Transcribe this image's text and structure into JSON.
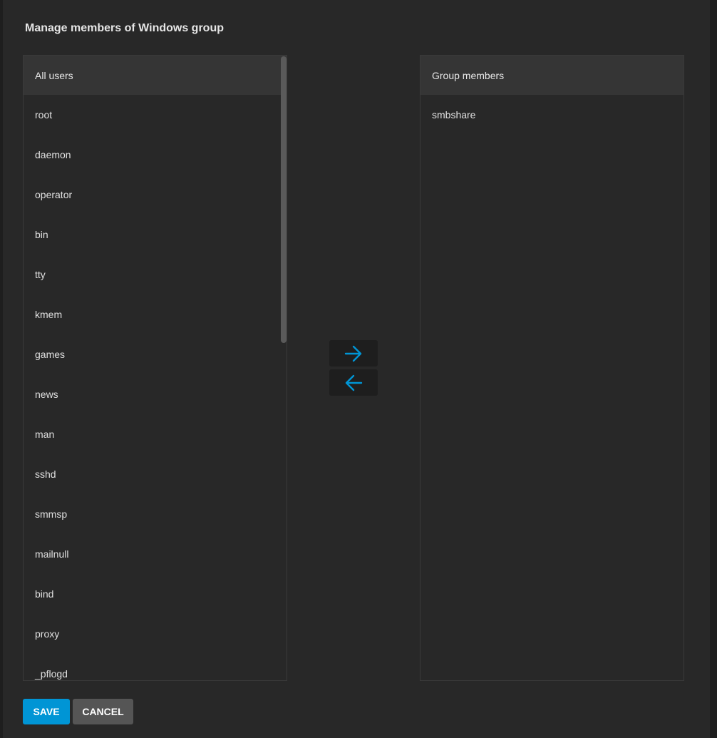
{
  "dialog": {
    "title": "Manage members of Windows group"
  },
  "all_users": {
    "header": "All users",
    "items": [
      "root",
      "daemon",
      "operator",
      "bin",
      "tty",
      "kmem",
      "games",
      "news",
      "man",
      "sshd",
      "smmsp",
      "mailnull",
      "bind",
      "proxy",
      "_pflogd"
    ]
  },
  "group_members": {
    "header": "Group members",
    "items": [
      "smbshare"
    ]
  },
  "transfer": {
    "add_icon": "arrow-right-icon",
    "remove_icon": "arrow-left-icon",
    "accent_color": "#0095d5"
  },
  "actions": {
    "save_label": "SAVE",
    "cancel_label": "CANCEL"
  }
}
